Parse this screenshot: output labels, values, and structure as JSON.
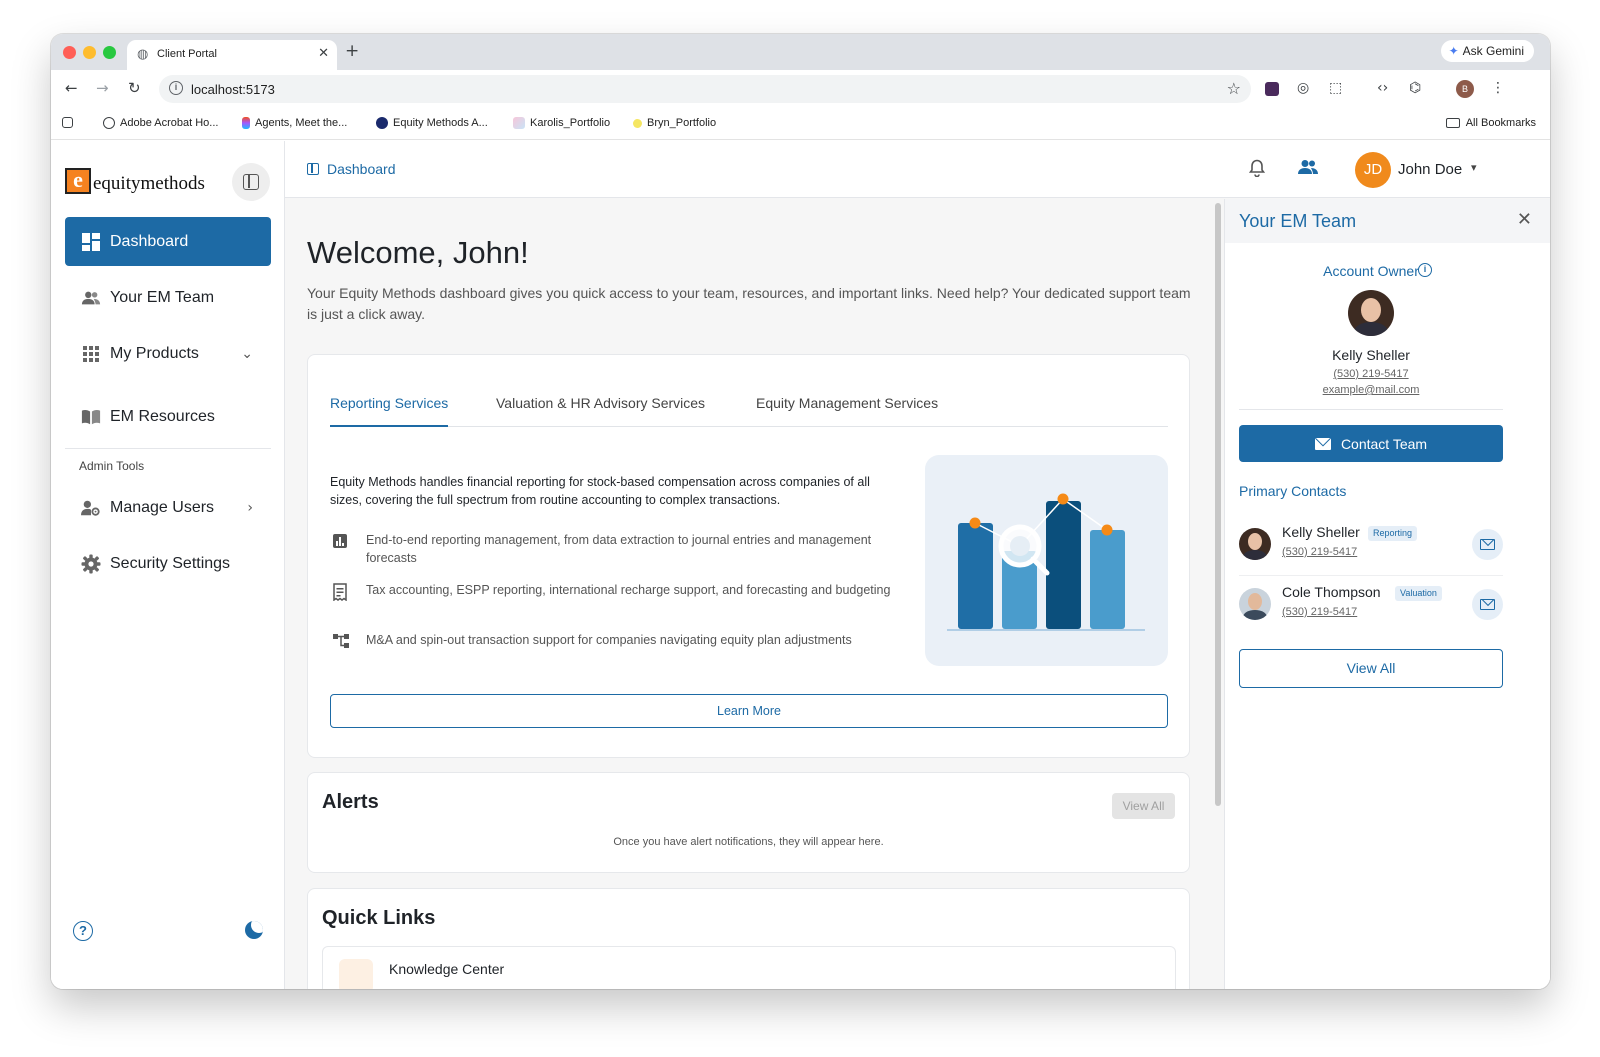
{
  "browser": {
    "tab_title": "Client Portal",
    "url": "localhost:5173",
    "gemini_label": "Ask Gemini",
    "profile_initial": "B",
    "bookmarks": [
      "Adobe Acrobat Ho...",
      "Agents, Meet the...",
      "Equity Methods A...",
      "Karolis_Portfolio",
      "Bryn_Portfolio"
    ],
    "all_bookmarks": "All Bookmarks"
  },
  "sidebar": {
    "logo_mark": "e",
    "logo_text": "equitymethods",
    "items": [
      {
        "label": "Dashboard",
        "icon": "dashboard-icon",
        "active": true
      },
      {
        "label": "Your EM Team",
        "icon": "people-icon"
      },
      {
        "label": "My Products",
        "icon": "apps-grid-icon"
      },
      {
        "label": "EM Resources",
        "icon": "book-icon"
      }
    ],
    "admin_label": "Admin Tools",
    "admin_items": [
      {
        "label": "Manage Users",
        "icon": "manage-users-icon"
      },
      {
        "label": "Security Settings",
        "icon": "gear-icon"
      }
    ],
    "help_glyph": "?"
  },
  "header": {
    "breadcrumb": "Dashboard",
    "user_initials": "JD",
    "user_name": "John Doe"
  },
  "main": {
    "welcome": "Welcome, John!",
    "intro": "Your Equity Methods dashboard gives you quick access to your team, resources, and important links. Need help? Your dedicated support team is just a click away.",
    "services": {
      "tabs": [
        "Reporting Services",
        "Valuation & HR Advisory Services",
        "Equity Management Services"
      ],
      "description": "Equity Methods handles financial reporting for stock-based compensation across companies of all sizes, covering the full spectrum from routine accounting to complex transactions.",
      "points": [
        {
          "text": "End-to-end reporting management, from data extraction to journal entries and management forecasts",
          "icon": "bar-chart-icon"
        },
        {
          "text": "Tax accounting, ESPP reporting, international recharge support, and forecasting and budgeting",
          "icon": "receipt-icon"
        },
        {
          "text": "M&A and spin-out transaction support for companies navigating equity plan adjustments",
          "icon": "hierarchy-icon"
        }
      ],
      "learn_more": "Learn More"
    },
    "alerts": {
      "title": "Alerts",
      "view_all": "View All",
      "empty": "Once you have alert notifications, they will appear here."
    },
    "quick_links": {
      "title": "Quick Links",
      "items": [
        "Knowledge Center"
      ]
    }
  },
  "team_panel": {
    "title": "Your EM Team",
    "owner_label": "Account Owner",
    "owner": {
      "name": "Kelly Sheller",
      "phone": "(530) 219-5417",
      "email": "example@mail.com"
    },
    "contact_button": "Contact Team",
    "primary_label": "Primary Contacts",
    "contacts": [
      {
        "name": "Kelly Sheller",
        "badge": "Reporting",
        "phone": "(530) 219-5417"
      },
      {
        "name": "Cole Thompson",
        "badge": "Valuation",
        "phone": "(530) 219-5417"
      }
    ],
    "view_all": "View All"
  },
  "colors": {
    "accent": "#1d6aa5",
    "brand_orange": "#f58220",
    "avatar": "#f08a1c"
  }
}
